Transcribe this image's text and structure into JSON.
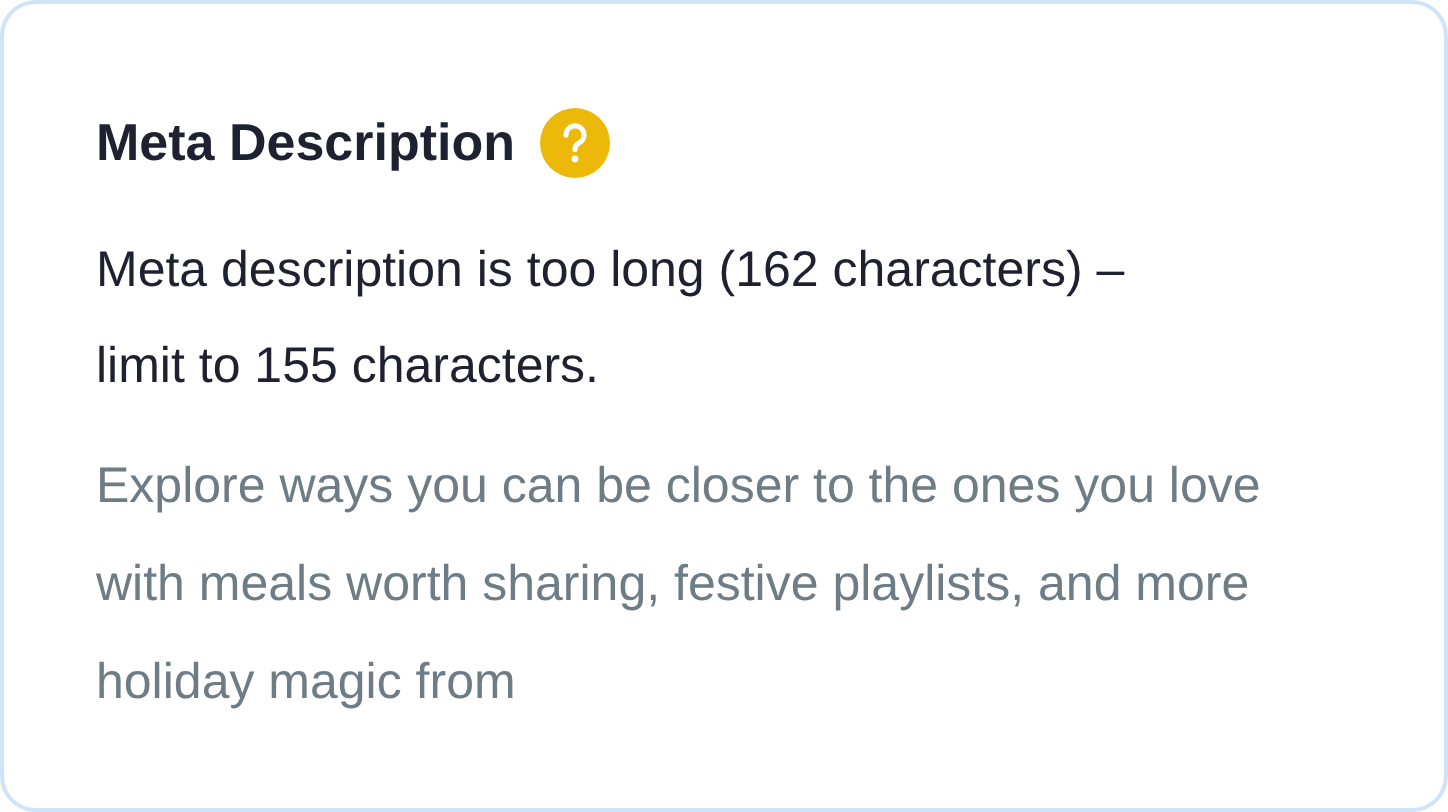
{
  "card": {
    "title": "Meta Description",
    "message": "Meta description is too long (162 characters) – limit to 155 characters.",
    "description": "Explore ways you can be closer to the ones you love with meals worth sharing, festive playlists, and more holiday magic from"
  }
}
